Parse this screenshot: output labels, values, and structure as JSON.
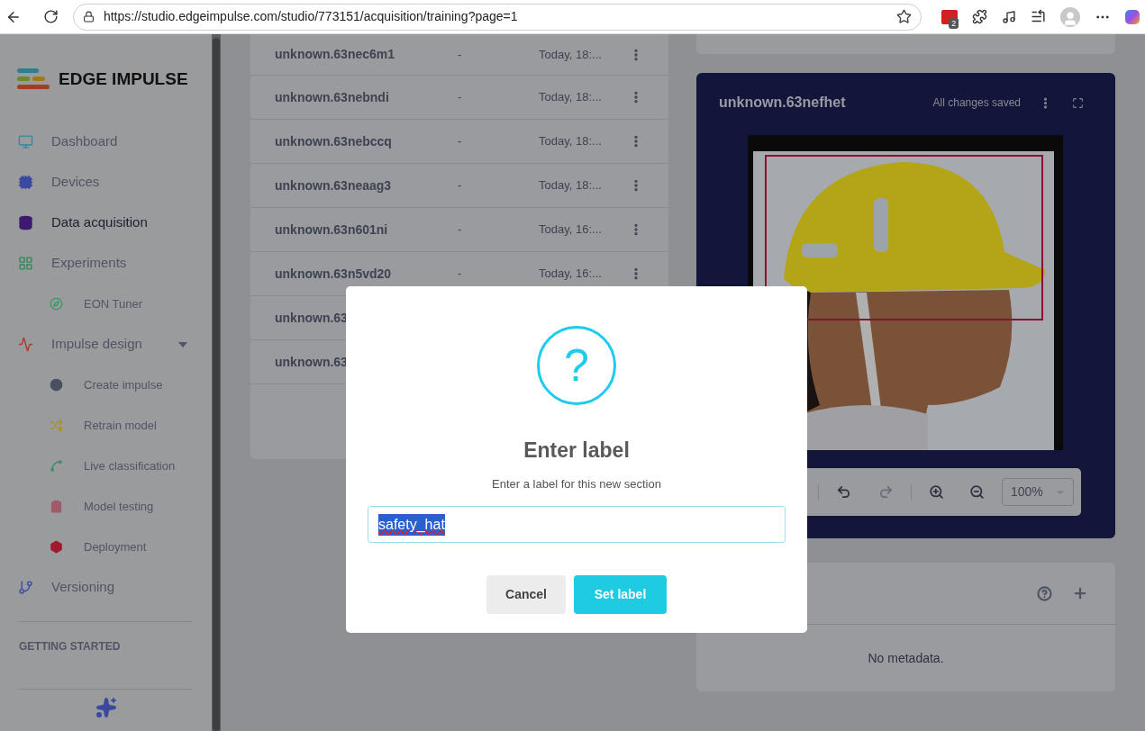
{
  "browser": {
    "url": "https://studio.edgeimpulse.com/studio/773151/acquisition/training?page=1",
    "extension_badge": "2"
  },
  "sidebar": {
    "brand": "EDGE IMPULSE",
    "items": [
      {
        "kind": "dashboard",
        "label": "Dashboard",
        "selected": false
      },
      {
        "kind": "devices",
        "label": "Devices",
        "selected": false
      },
      {
        "kind": "data",
        "label": "Data acquisition",
        "selected": true
      },
      {
        "kind": "experiments",
        "label": "Experiments",
        "selected": false,
        "children": [
          {
            "kind": "eon",
            "label": "EON Tuner",
            "selected": false
          }
        ]
      },
      {
        "kind": "impulse",
        "label": "Impulse design",
        "selected": false,
        "expanded": true,
        "children": [
          {
            "kind": "create",
            "label": "Create impulse",
            "selected": false
          },
          {
            "kind": "retrain",
            "label": "Retrain model",
            "selected": false
          },
          {
            "kind": "live",
            "label": "Live classification",
            "selected": false
          },
          {
            "kind": "testing",
            "label": "Model testing",
            "selected": false
          },
          {
            "kind": "deploy",
            "label": "Deployment",
            "selected": false
          }
        ]
      },
      {
        "kind": "versioning",
        "label": "Versioning",
        "selected": false
      }
    ],
    "section_heading": "GETTING STARTED"
  },
  "samples": [
    {
      "name": "unknown.63nec6m1",
      "label": "-",
      "added": "Today, 18:..."
    },
    {
      "name": "unknown.63nebndi",
      "label": "-",
      "added": "Today, 18:..."
    },
    {
      "name": "unknown.63nebccq",
      "label": "-",
      "added": "Today, 18:..."
    },
    {
      "name": "unknown.63neaag3",
      "label": "-",
      "added": "Today, 18:..."
    },
    {
      "name": "unknown.63n601ni",
      "label": "-",
      "added": "Today, 16:..."
    },
    {
      "name": "unknown.63n5vd20",
      "label": "-",
      "added": "Today, 16:..."
    },
    {
      "name": "unknown.63"
    },
    {
      "name": "unknown.63"
    }
  ],
  "sample_viewer": {
    "title": "unknown.63nefhet",
    "status": "All changes saved",
    "zoom": "100%"
  },
  "metadata": {
    "empty_text": "No metadata."
  },
  "dialog": {
    "icon": "?",
    "title": "Enter label",
    "message": "Enter a label for this new section",
    "input": {
      "value": "safety_hat",
      "selected": true
    },
    "buttons": [
      {
        "kind": "secondary",
        "label": "Cancel"
      },
      {
        "kind": "primary",
        "label": "Set label"
      }
    ]
  }
}
